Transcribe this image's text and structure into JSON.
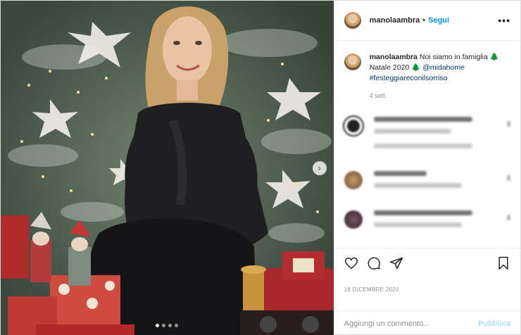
{
  "post": {
    "username": "manolaambra",
    "follow_separator": "•",
    "follow_label": "Segui",
    "more_label": "•••",
    "caption_text": "Noi siamo in famiglia 🌲Natale 2020 🌲",
    "caption_mention": "@midahome",
    "caption_hashtag": "#festeggiareconilsorriso",
    "caption_age": "4 sett.",
    "date": "18 DICEMBRE 2020",
    "comment_placeholder": "Aggiungi un commento...",
    "publish_label": "Pubblica",
    "carousel": {
      "slides": 4,
      "active_index": 1
    }
  },
  "icons": [
    "heart-icon",
    "comment-icon",
    "share-icon",
    "bookmark-icon",
    "next-arrow-icon",
    "more-icon"
  ],
  "colors": {
    "accent": "#0095f6",
    "publish_disabled": "#b2dffc",
    "link": "#00376b",
    "muted": "#8e8e8e"
  }
}
